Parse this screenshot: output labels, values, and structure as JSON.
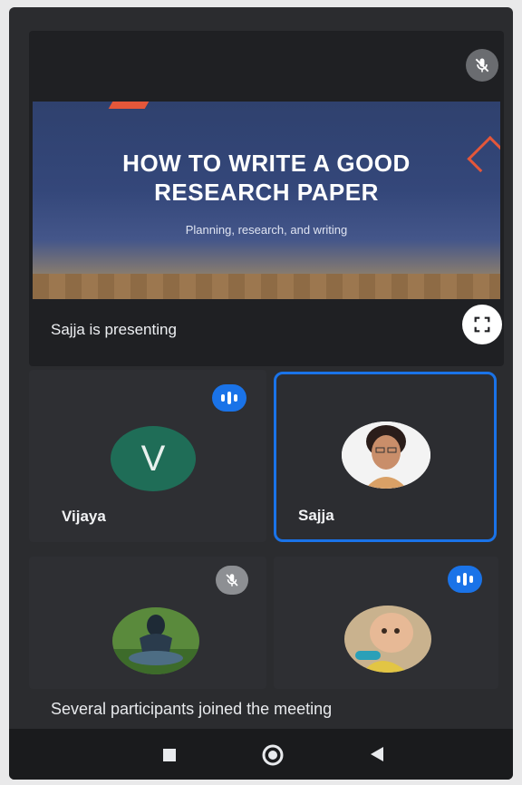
{
  "presentation": {
    "slide_title_line1": "HOW TO WRITE A GOOD",
    "slide_title_line2": "RESEARCH PAPER",
    "slide_subtitle": "Planning, research, and writing",
    "presenting_text": "Sajja is presenting"
  },
  "participants": [
    {
      "name": "Vijaya",
      "initial": "V",
      "status": "speaking"
    },
    {
      "name": "Sajja",
      "status": "active-speaker"
    },
    {
      "name": "",
      "status": "muted"
    },
    {
      "name": "",
      "status": "speaking"
    }
  ],
  "toast": "Several participants joined the meeting",
  "icons": {
    "mic_off": "mic-off-icon",
    "fullscreen": "fullscreen-icon",
    "audio_level": "audio-level-icon",
    "nav_recents": "square-icon",
    "nav_home": "circle-icon",
    "nav_back": "triangle-icon"
  },
  "colors": {
    "speaking_accent": "#1a73e8",
    "avatar_v": "#1f6d57",
    "background": "#2b2c2f"
  }
}
